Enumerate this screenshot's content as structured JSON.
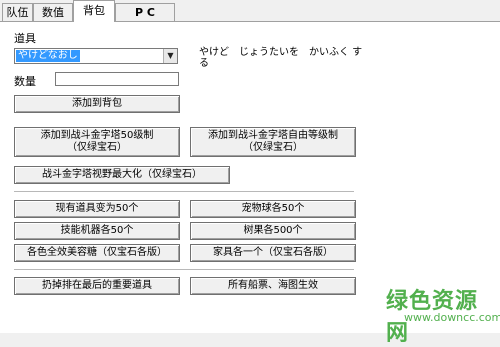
{
  "tabs": [
    {
      "label": "队伍"
    },
    {
      "label": "数值"
    },
    {
      "label": "背包"
    },
    {
      "label": "P C"
    }
  ],
  "item_label": "道具",
  "item_select_value": "やけどなおし",
  "item_description": "やけど　じょうたいを　かいふく する",
  "quantity_label": "数量",
  "quantity_value": "",
  "buttons": {
    "add_to_bag": "添加到背包",
    "add_tower_50": "添加到战斗金字塔50级制\n（仅绿宝石）",
    "add_tower_free": "添加到战斗金字塔自由等级制\n（仅绿宝石）",
    "tower_vision_max": "战斗金字塔视野最大化（仅绿宝石）",
    "items_to_50": "现有道具变为50个",
    "pokeballs_50": "宠物球各50个",
    "tms_50": "技能机器各50个",
    "berries_500": "树果各500个",
    "pokeblocks": "各色全效美容糖（仅宝石各版）",
    "decorations": "家具各一个（仅宝石各版）",
    "discard_key_items": "扔掉排在最后的重要道具",
    "all_tickets": "所有船票、海图生效"
  },
  "watermark": {
    "title": "绿色资源网",
    "url": "www.downcc.com",
    "color": "#52b04e"
  }
}
